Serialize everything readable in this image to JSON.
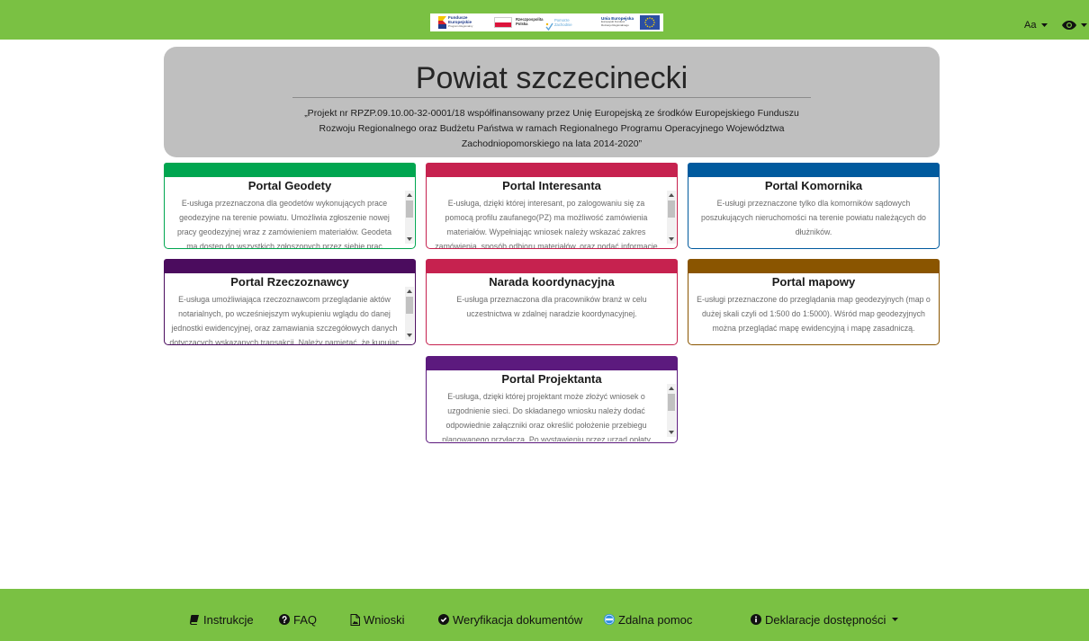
{
  "colors": {
    "topbar": "#7ac143",
    "footer": "#7ac143",
    "header_bg": "#bfbfbf"
  },
  "topbar": {
    "logos": {
      "fe": [
        "Fundusze",
        "Europejskie",
        "Program Regionalny"
      ],
      "pl": [
        "Rzeczpospolita",
        "Polska"
      ],
      "pz": [
        "Pomorze",
        "Zachodnie"
      ],
      "ue": [
        "Unia Europejska",
        "Europejski Fundusz",
        "Rozwoju Regionalnego"
      ]
    },
    "font_size_control": {
      "label": "Aa",
      "icon": "chevron-down-icon"
    },
    "contrast_control": {
      "icon": "eye-icon"
    }
  },
  "header": {
    "title": "Powiat szczecinecki",
    "project_lines": [
      "„Projekt nr RPZP.09.10.00-32-0001/18 współfinansowany przez Unię Europejską ze środków Europejskiego Funduszu",
      "Rozwoju Regionalnego oraz Budżetu Państwa w ramach Regionalnego Programu Operacyjnego Województwa",
      "Zachodniopomorskiego na lata 2014-2020”"
    ]
  },
  "cards": [
    {
      "title": "Portal Geodety",
      "color": "#00a650",
      "lines": [
        "E-usługa przeznaczona dla geodetów wykonujących prace",
        "geodezyjne na terenie powiatu. Umożliwia zgłoszenie nowej",
        "pracy geodezyjnej wraz z zamówieniem materiałów. Geodeta",
        "ma dostęp do wszystkich zgłoszonych przez siebie prac"
      ]
    },
    {
      "title": "Portal Interesanta",
      "color": "#c6224f",
      "lines": [
        "E-usługa, dzięki której interesant, po zalogowaniu się za",
        "pomocą profilu zaufanego(PZ) ma możliwość zamówienia",
        "materiałów. Wypełniając wniosek należy wskazać zakres",
        "zamówienia, sposób odbioru materiałów, oraz podać informacje"
      ]
    },
    {
      "title": "Portal Komornika",
      "color": "#005a9e",
      "lines": [
        "E-usługi przeznaczone tylko dla komorników sądowych",
        "poszukujących nieruchomości na terenie powiatu należących do",
        "dłużników."
      ]
    },
    {
      "title": "Portal Rzeczoznawcy",
      "color": "#4b0c5e",
      "lines": [
        "E-usługa umożliwiająca rzeczoznawcom przeglądanie aktów",
        "notarialnych, po wcześniejszym wykupieniu wglądu do danej",
        "jednostki ewidencyjnej, oraz zamawiania szczegółowych danych",
        "dotyczących wskazanych transakcji. Należy pamiętać, że kupując"
      ]
    },
    {
      "title": "Narada koordynacyjna",
      "color": "#c6224f",
      "lines": [
        "E-usługa przeznaczona dla pracowników branż w celu",
        "uczestnictwa w zdalnej naradzie koordynacyjnej."
      ]
    },
    {
      "title": "Portal mapowy",
      "color": "#8a5500",
      "lines": [
        "E-usługi przeznaczone do przeglądania map geodezyjnych (map o",
        "dużej skali czyli od 1:500 do 1:5000). Wśród map geodezyjnych",
        "można przeglądać mapę ewidencyjną i mapę zasadniczą."
      ]
    },
    {
      "title": "Portal Projektanta",
      "color": "#5c1a7e",
      "lines": [
        "E-usługa, dzięki której projektant może złożyć wniosek o",
        "uzgodnienie sieci. Do składanego wniosku należy dodać",
        "odpowiednie załączniki oraz określić położenie przebiegu",
        "planowanego przyłącza. Po wystawieniu przez urząd opłaty"
      ]
    }
  ],
  "footer": {
    "items": [
      {
        "label": "Instrukcje",
        "icon": "book-icon"
      },
      {
        "label": "FAQ",
        "icon": "question-circle-icon"
      },
      {
        "label": "Wnioski",
        "icon": "file-icon"
      },
      {
        "label": "Weryfikacja dokumentów",
        "icon": "check-circle-icon"
      },
      {
        "label": "Zdalna pomoc",
        "icon": "remote-help-icon"
      },
      {
        "label": "Deklaracje dostępności",
        "icon": "info-circle-icon"
      }
    ]
  }
}
